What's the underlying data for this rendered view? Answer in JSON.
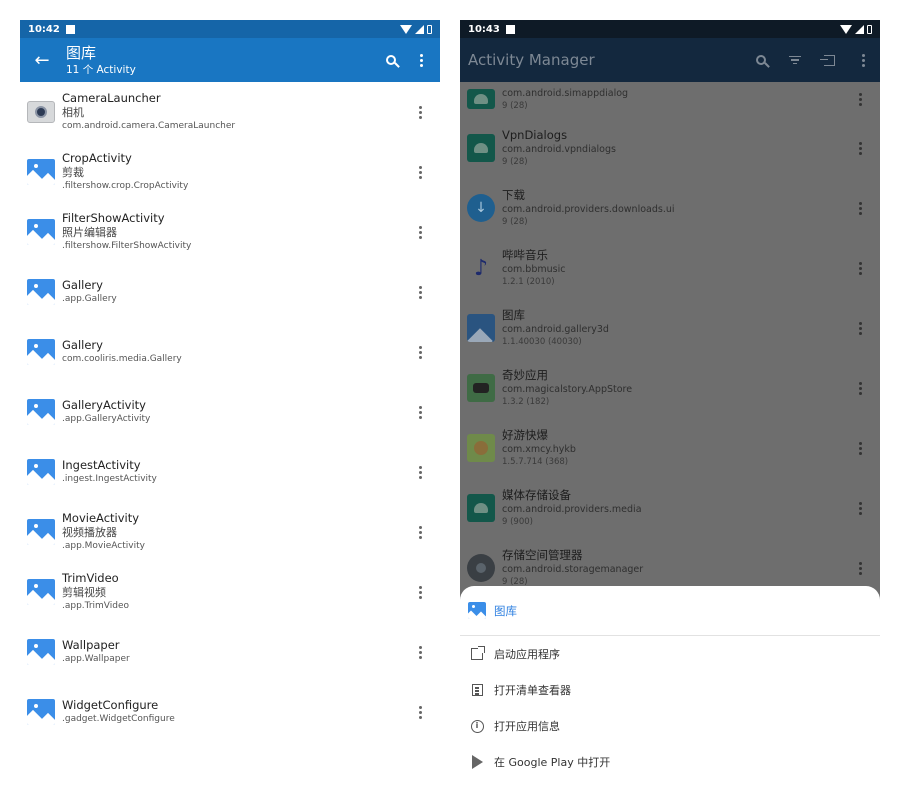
{
  "left": {
    "status_time": "10:42",
    "toolbar": {
      "title": "图库",
      "subtitle": "11 个 Activity"
    },
    "activities": [
      {
        "name": "CameraLauncher",
        "label": "相机",
        "class": "com.android.camera.CameraLauncher",
        "icon": "camera-icon"
      },
      {
        "name": "CropActivity",
        "label": "剪裁",
        "class": ".filtershow.crop.CropActivity",
        "icon": "gallery-icon"
      },
      {
        "name": "FilterShowActivity",
        "label": "照片编辑器",
        "class": ".filtershow.FilterShowActivity",
        "icon": "gallery-icon"
      },
      {
        "name": "Gallery",
        "label": "",
        "class": ".app.Gallery",
        "icon": "gallery-icon"
      },
      {
        "name": "Gallery",
        "label": "",
        "class": "com.cooliris.media.Gallery",
        "icon": "gallery-icon"
      },
      {
        "name": "GalleryActivity",
        "label": "",
        "class": ".app.GalleryActivity",
        "icon": "gallery-icon"
      },
      {
        "name": "IngestActivity",
        "label": "",
        "class": ".ingest.IngestActivity",
        "icon": "gallery-icon"
      },
      {
        "name": "MovieActivity",
        "label": "视频播放器",
        "class": ".app.MovieActivity",
        "icon": "gallery-icon"
      },
      {
        "name": "TrimVideo",
        "label": "剪辑视频",
        "class": ".app.TrimVideo",
        "icon": "gallery-icon"
      },
      {
        "name": "Wallpaper",
        "label": "",
        "class": ".app.Wallpaper",
        "icon": "gallery-icon"
      },
      {
        "name": "WidgetConfigure",
        "label": "",
        "class": ".gadget.WidgetConfigure",
        "icon": "gallery-icon"
      }
    ]
  },
  "right": {
    "status_time": "10:43",
    "toolbar": {
      "title": "Activity Manager"
    },
    "apps": [
      {
        "name": "",
        "package": "com.android.simappdialog",
        "version": "9 (28)",
        "icon": "android-icon"
      },
      {
        "name": "VpnDialogs",
        "package": "com.android.vpndialogs",
        "version": "9 (28)",
        "icon": "android-icon"
      },
      {
        "name": "下载",
        "package": "com.android.providers.downloads.ui",
        "version": "9 (28)",
        "icon": "download-icon"
      },
      {
        "name": "哔哔音乐",
        "package": "com.bbmusic",
        "version": "1.2.1 (2010)",
        "icon": "music-icon"
      },
      {
        "name": "图库",
        "package": "com.android.gallery3d",
        "version": "1.1.40030 (40030)",
        "icon": "gallery-icon"
      },
      {
        "name": "奇妙应用",
        "package": "com.magicalstory.AppStore",
        "version": "1.3.2 (182)",
        "icon": "magic-icon"
      },
      {
        "name": "好游快爆",
        "package": "com.xmcy.hykb",
        "version": "1.5.7.714 (368)",
        "icon": "game-icon"
      },
      {
        "name": "媒体存储设备",
        "package": "com.android.providers.media",
        "version": "9 (900)",
        "icon": "android-icon"
      },
      {
        "name": "存储空间管理器",
        "package": "com.android.storagemanager",
        "version": "9 (28)",
        "icon": "storage-icon"
      }
    ],
    "sheet": {
      "title": "图库",
      "actions": [
        {
          "label": "启动应用程序",
          "icon": "launch-icon"
        },
        {
          "label": "打开清单查看器",
          "icon": "list-icon"
        },
        {
          "label": "打开应用信息",
          "icon": "info-icon"
        },
        {
          "label": "在 Google Play 中打开",
          "icon": "play-store-icon"
        }
      ]
    }
  },
  "colors": {
    "left_toolbar": "#1976c2",
    "right_toolbar_dimmed": "#13283e",
    "accent": "#2d7fe0"
  }
}
